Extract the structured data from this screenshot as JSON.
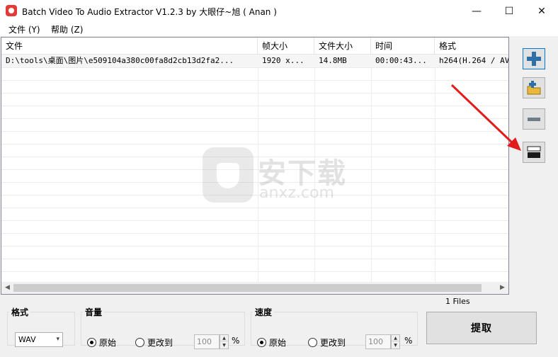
{
  "window": {
    "title": "Batch Video To Audio Extractor V1.2.3 by 大眼仔~旭 ( Anan )",
    "minimize_glyph": "—",
    "maximize_glyph": "☐",
    "close_glyph": "✕"
  },
  "menu": {
    "file": "文件 (Y)",
    "help": "帮助 (Z)"
  },
  "table": {
    "columns": [
      "文件",
      "帧大小",
      "文件大小",
      "时间",
      "格式"
    ],
    "rows": [
      {
        "file": "D:\\tools\\桌面\\图片\\e509104a380c00fa8d2cb13d2fa2...",
        "frame_size": "1920 x...",
        "file_size": "14.8MB",
        "time": "00:00:43...",
        "format": "h264(H.264 / AV"
      }
    ]
  },
  "scrollbar": {
    "left_arrow": "◀",
    "right_arrow": "▶"
  },
  "side_buttons": {
    "add_icon": "plus-icon",
    "add_folder_icon": "add-folder-icon",
    "remove_icon": "minus-icon",
    "clear_icon": "clear-list-icon"
  },
  "watermark": {
    "cn": "安下载",
    "en": "anxz.com"
  },
  "files_count": "1 Files",
  "format_group": {
    "label": "格式",
    "selected": "WAV",
    "arrow": "▾"
  },
  "volume_group": {
    "label": "音量",
    "original": "原始",
    "change_to": "更改到",
    "value": "100",
    "unit": "%",
    "selected": "original"
  },
  "speed_group": {
    "label": "速度",
    "original": "原始",
    "change_to": "更改到",
    "value": "100",
    "unit": "%",
    "selected": "original"
  },
  "extract_button": "提取",
  "colors": {
    "accent": "#0078d7",
    "icon_blue": "#2f6fa8",
    "selected_row": "#f5f5f5",
    "watermark": "#9a9a9a"
  }
}
